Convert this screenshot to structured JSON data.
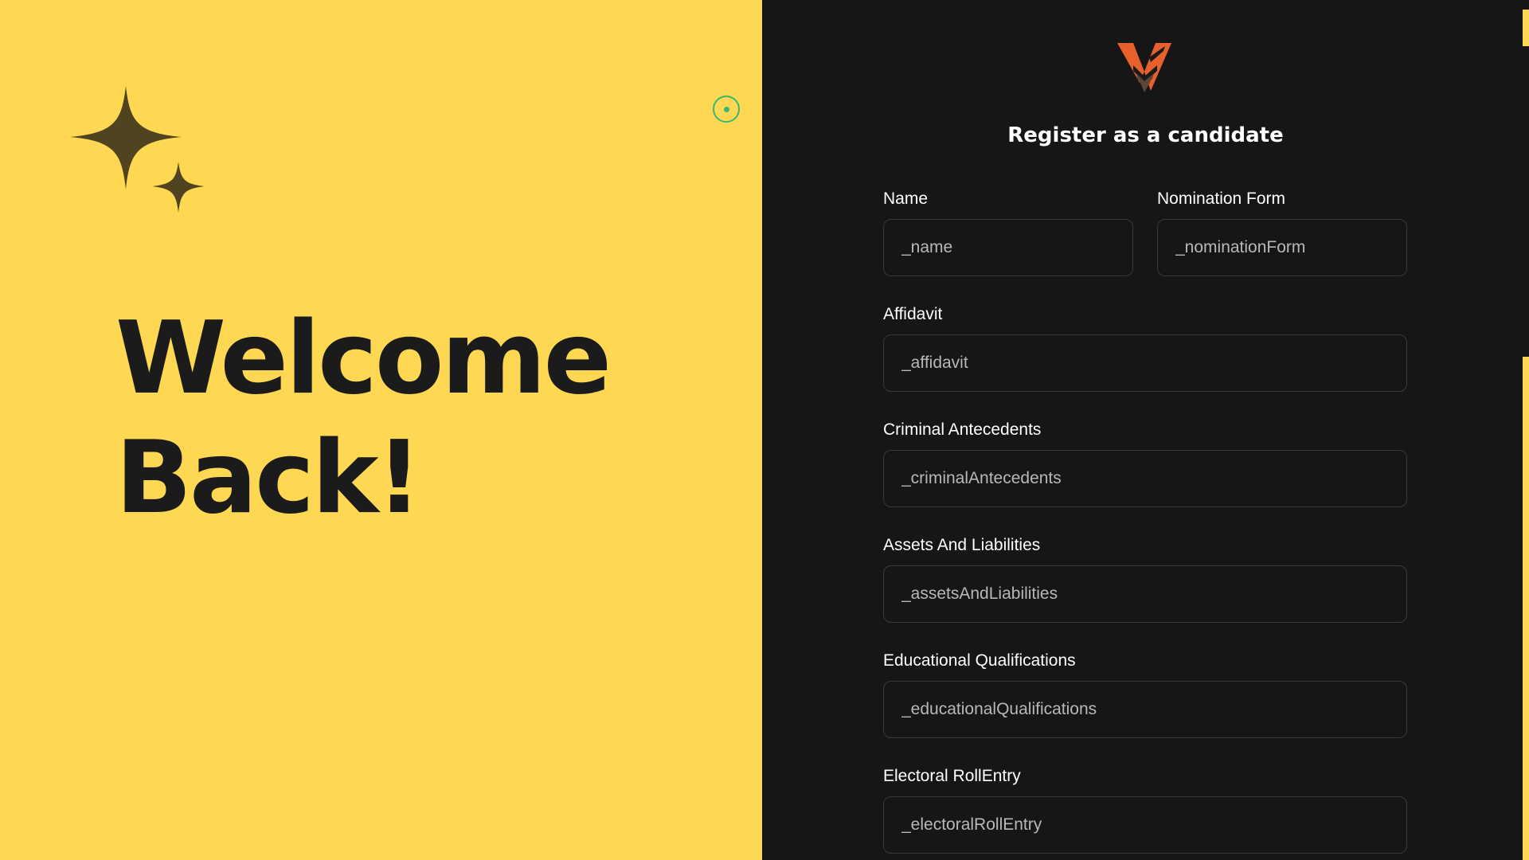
{
  "welcome": {
    "line1": "Welcome",
    "line2": "Back!"
  },
  "form": {
    "title": "Register as a candidate",
    "fields": {
      "name": {
        "label": "Name",
        "placeholder": "_name"
      },
      "nomination_form": {
        "label": "Nomination Form",
        "placeholder": "_nominationForm"
      },
      "affidavit": {
        "label": "Affidavit",
        "placeholder": "_affidavit"
      },
      "criminal_antecedents": {
        "label": "Criminal Antecedents",
        "placeholder": "_criminalAntecedents"
      },
      "assets_and_liabilities": {
        "label": "Assets And Liabilities",
        "placeholder": "_assetsAndLiabilities"
      },
      "educational_qualifications": {
        "label": "Educational Qualifications",
        "placeholder": "_educationalQualifications"
      },
      "electoral_roll_entry": {
        "label": "Electoral RollEntry",
        "placeholder": "_electoralRollEntry"
      }
    }
  },
  "icons": {
    "sparkle": "sparkle-icon",
    "logo": "app-logo-icon",
    "cursor": "cursor-indicator"
  },
  "colors": {
    "left_background": "#FED852",
    "right_background": "#161616",
    "welcome_text": "#1b1b1b",
    "sparkle": "#4f4320",
    "logo_orange": "#e8612c",
    "logo_dark": "#5a4637",
    "cursor_ring": "#37b86f",
    "input_border": "#3a3a3a",
    "placeholder": "#b8b8b8"
  }
}
